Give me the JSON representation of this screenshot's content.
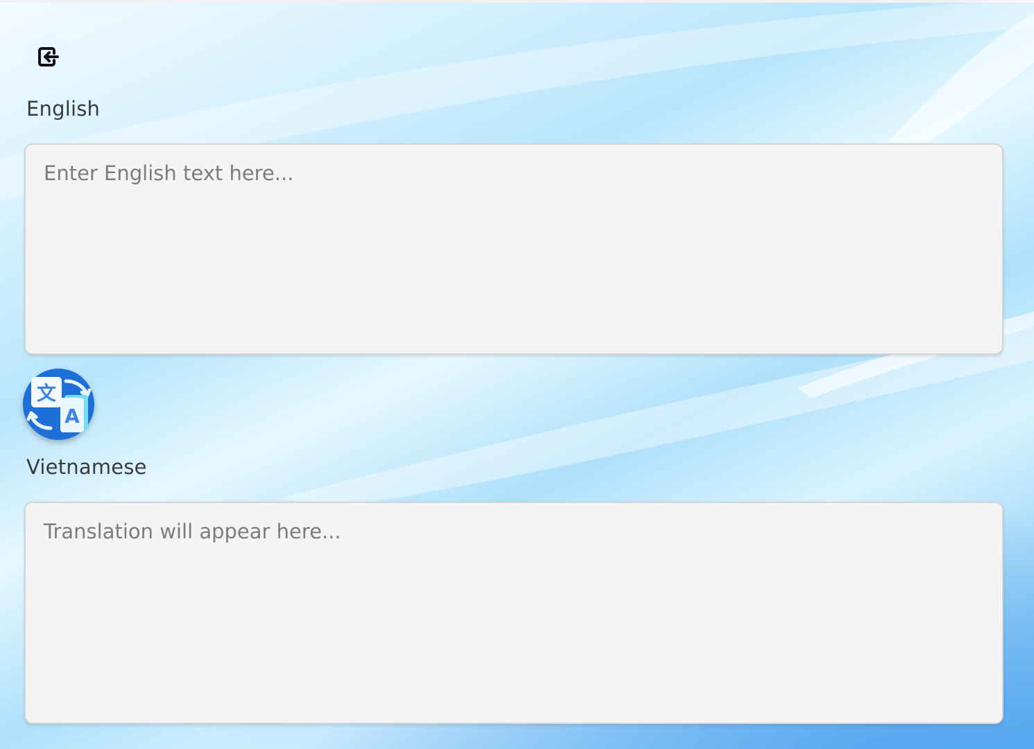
{
  "source": {
    "language_label": "English",
    "placeholder": "Enter English text here...",
    "value": ""
  },
  "target": {
    "language_label": "Vietnamese",
    "placeholder": "Translation will appear here...",
    "value": ""
  },
  "icons": {
    "exit": "exit-icon",
    "translate": "translate-icon"
  },
  "translate_icon_glyphs": {
    "source_glyph": "文",
    "target_glyph": "A"
  },
  "colors": {
    "accent": "#1f6fd9",
    "box_background": "#f4f4f4",
    "box_border": "#d1d4d9",
    "label_text": "#3b3b3b",
    "placeholder_text": "#7c7c7c"
  }
}
